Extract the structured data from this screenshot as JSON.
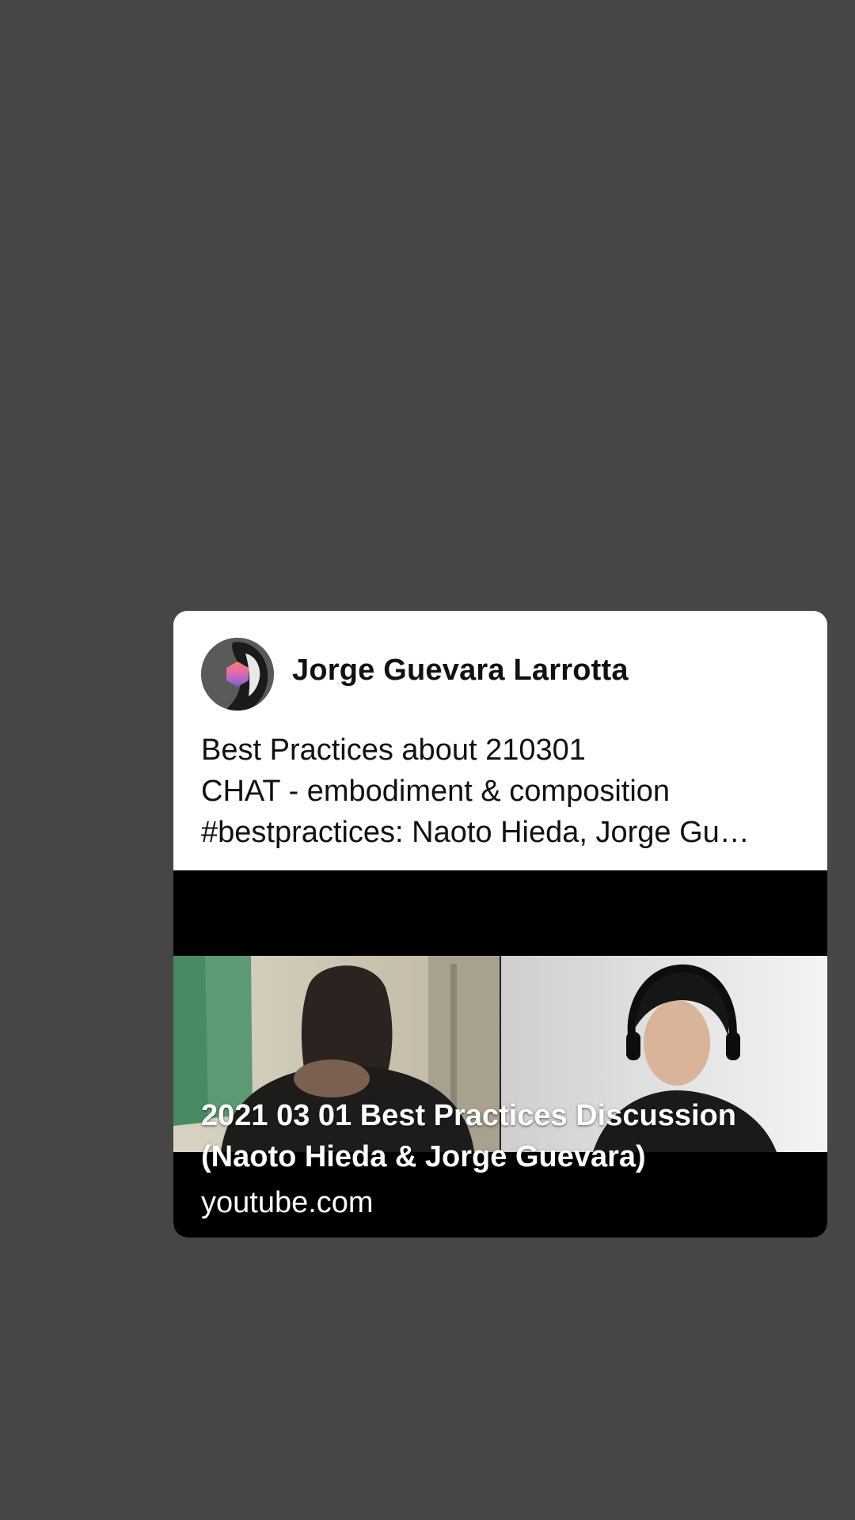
{
  "post": {
    "author_name": "Jorge Guevara Larrotta",
    "text_lines": [
      "Best Practices about 210301",
      "CHAT - embodiment & composition",
      "#bestpractices: Naoto Hieda, Jorge Gu…"
    ]
  },
  "link_preview": {
    "title_lines": [
      "2021 03 01 Best Practices Discussion",
      "(Naoto Hieda & Jorge Guevara)"
    ],
    "domain": "youtube.com"
  },
  "icons": {
    "avatar": "profile-avatar-icon"
  },
  "colors": {
    "background": "#464646",
    "card": "#ffffff",
    "media_background": "#000000"
  }
}
